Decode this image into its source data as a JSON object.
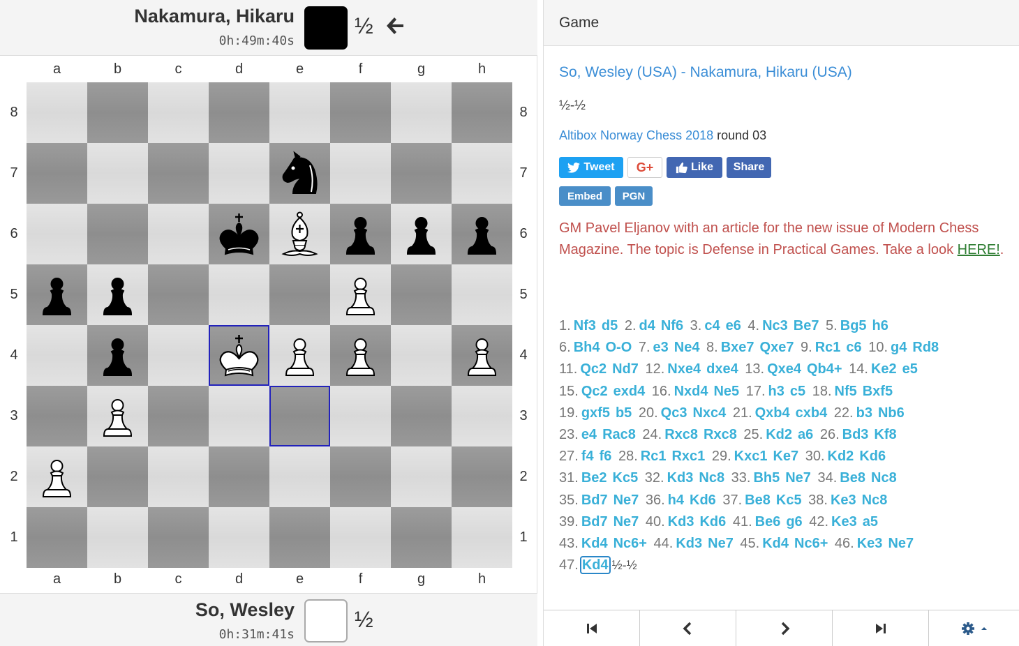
{
  "top_player": {
    "name": "Nakamura, Hikaru",
    "clock": "0h:49m:40s",
    "color": "#000000",
    "score": "½"
  },
  "bottom_player": {
    "name": "So, Wesley",
    "clock": "0h:31m:41s",
    "color": "#ffffff",
    "score": "½"
  },
  "files": [
    "a",
    "b",
    "c",
    "d",
    "e",
    "f",
    "g",
    "h"
  ],
  "ranks": [
    "8",
    "7",
    "6",
    "5",
    "4",
    "3",
    "2",
    "1"
  ],
  "board": {
    "pieces": [
      {
        "square": "e7",
        "piece": "black-knight"
      },
      {
        "square": "d6",
        "piece": "black-king"
      },
      {
        "square": "e6",
        "piece": "white-bishop"
      },
      {
        "square": "f6",
        "piece": "black-pawn"
      },
      {
        "square": "g6",
        "piece": "black-pawn"
      },
      {
        "square": "h6",
        "piece": "black-pawn"
      },
      {
        "square": "a5",
        "piece": "black-pawn"
      },
      {
        "square": "b5",
        "piece": "black-pawn"
      },
      {
        "square": "f5",
        "piece": "white-pawn"
      },
      {
        "square": "b4",
        "piece": "black-pawn"
      },
      {
        "square": "d4",
        "piece": "white-king"
      },
      {
        "square": "e4",
        "piece": "white-pawn"
      },
      {
        "square": "f4",
        "piece": "white-pawn"
      },
      {
        "square": "h4",
        "piece": "white-pawn"
      },
      {
        "square": "b3",
        "piece": "white-pawn"
      },
      {
        "square": "a2",
        "piece": "white-pawn"
      }
    ],
    "highlighted": [
      "d4",
      "e3"
    ]
  },
  "panel": {
    "header": "Game",
    "game_title": "So, Wesley (USA) - Nakamura, Hikaru (USA)",
    "result": "½-½",
    "event": "Altibox Norway Chess 2018",
    "round": "round 03",
    "share_buttons": {
      "tweet": "Tweet",
      "gplus": "G+",
      "like": "Like",
      "share": "Share"
    },
    "embed": "Embed",
    "pgn": "PGN",
    "note_text": "GM Pavel Eljanov with an article for the new issue of Modern Chess Magazine. The topic is Defense in Practical Games. Take a look ",
    "note_link": "HERE!",
    "note_end": ".",
    "colors": {
      "link": "#3a8dd6",
      "move": "#39b0d8",
      "note": "#c0504d",
      "tweet": "#1da1f2",
      "facebook": "#4267b2"
    }
  },
  "moves": [
    [
      [
        "1.",
        "Nf3",
        "d5"
      ],
      [
        "2.",
        "d4",
        "Nf6"
      ],
      [
        "3.",
        "c4",
        "e6"
      ],
      [
        "4.",
        "Nc3",
        "Be7"
      ],
      [
        "5.",
        "Bg5",
        "h6"
      ]
    ],
    [
      [
        "6.",
        "Bh4",
        "O-O"
      ],
      [
        "7.",
        "e3",
        "Ne4"
      ],
      [
        "8.",
        "Bxe7",
        "Qxe7"
      ],
      [
        "9.",
        "Rc1",
        "c6"
      ],
      [
        "10.",
        "g4",
        "Rd8"
      ]
    ],
    [
      [
        "11.",
        "Qc2",
        "Nd7"
      ],
      [
        "12.",
        "Nxe4",
        "dxe4"
      ],
      [
        "13.",
        "Qxe4",
        "Qb4+"
      ],
      [
        "14.",
        "Ke2",
        "e5"
      ]
    ],
    [
      [
        "15.",
        "Qc2",
        "exd4"
      ],
      [
        "16.",
        "Nxd4",
        "Ne5"
      ],
      [
        "17.",
        "h3",
        "c5"
      ],
      [
        "18.",
        "Nf5",
        "Bxf5"
      ]
    ],
    [
      [
        "19.",
        "gxf5",
        "b5"
      ],
      [
        "20.",
        "Qc3",
        "Nxc4"
      ],
      [
        "21.",
        "Qxb4",
        "cxb4"
      ],
      [
        "22.",
        "b3",
        "Nb6"
      ]
    ],
    [
      [
        "23.",
        "e4",
        "Rac8"
      ],
      [
        "24.",
        "Rxc8",
        "Rxc8"
      ],
      [
        "25.",
        "Kd2",
        "a6"
      ],
      [
        "26.",
        "Bd3",
        "Kf8"
      ]
    ],
    [
      [
        "27.",
        "f4",
        "f6"
      ],
      [
        "28.",
        "Rc1",
        "Rxc1"
      ],
      [
        "29.",
        "Kxc1",
        "Ke7"
      ],
      [
        "30.",
        "Kd2",
        "Kd6"
      ]
    ],
    [
      [
        "31.",
        "Be2",
        "Kc5"
      ],
      [
        "32.",
        "Kd3",
        "Nc8"
      ],
      [
        "33.",
        "Bh5",
        "Ne7"
      ],
      [
        "34.",
        "Be8",
        "Nc8"
      ]
    ],
    [
      [
        "35.",
        "Bd7",
        "Ne7"
      ],
      [
        "36.",
        "h4",
        "Kd6"
      ],
      [
        "37.",
        "Be8",
        "Kc5"
      ],
      [
        "38.",
        "Ke3",
        "Nc8"
      ]
    ],
    [
      [
        "39.",
        "Bd7",
        "Ne7"
      ],
      [
        "40.",
        "Kd3",
        "Kd6"
      ],
      [
        "41.",
        "Be6",
        "g6"
      ],
      [
        "42.",
        "Ke3",
        "a5"
      ]
    ],
    [
      [
        "43.",
        "Kd4",
        "Nc6+"
      ],
      [
        "44.",
        "Kd3",
        "Ne7"
      ],
      [
        "45.",
        "Kd4",
        "Nc6+"
      ],
      [
        "46.",
        "Ke3",
        "Ne7"
      ]
    ],
    [
      [
        "47.",
        "Kd4"
      ]
    ]
  ],
  "final_result": "½-½",
  "current_move": "47.Kd4",
  "nav": [
    "first-move-icon",
    "previous-move-icon",
    "next-move-icon",
    "last-move-icon",
    "settings-icon"
  ]
}
